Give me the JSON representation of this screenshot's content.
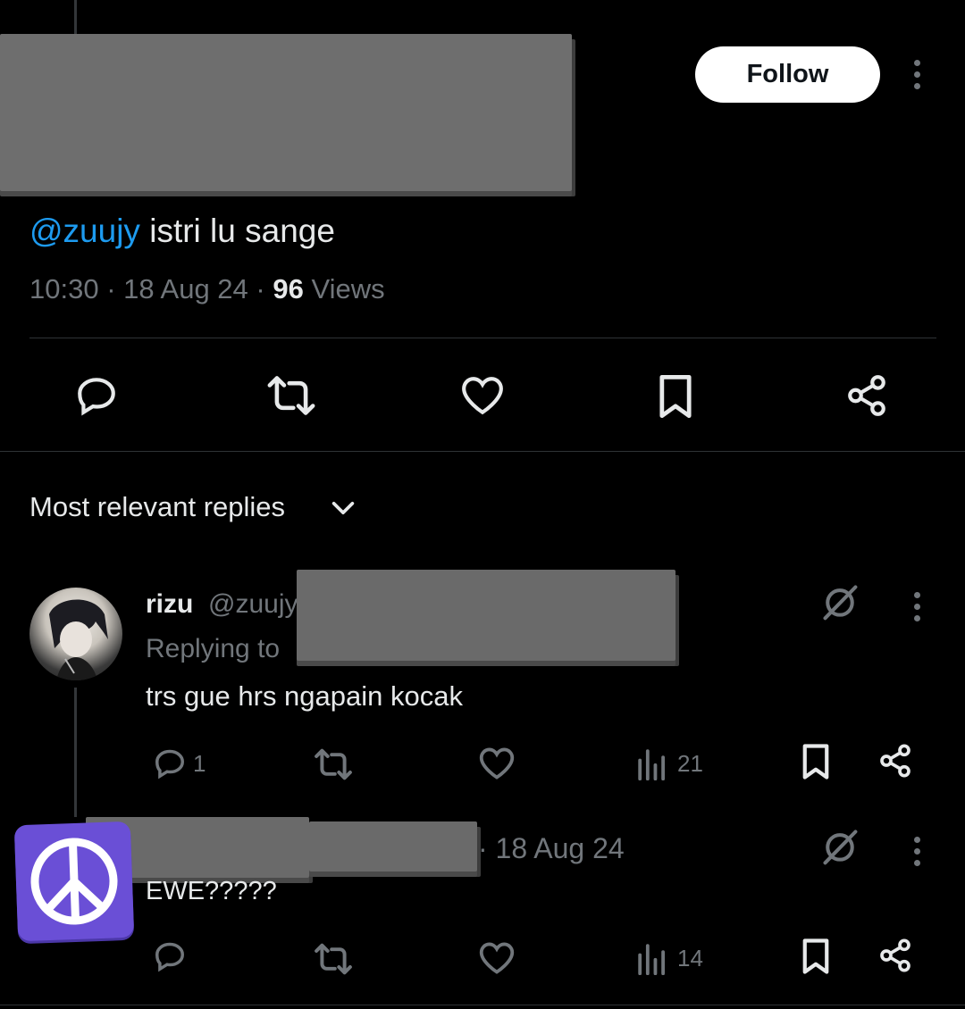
{
  "tweet": {
    "follow_label": "Follow",
    "mention": "@zuujy",
    "text": " istri lu sange",
    "time": "10:30",
    "date": "18 Aug 24",
    "views_count": "96",
    "views_label": "Views",
    "separator": " · "
  },
  "replies_header": {
    "label": "Most relevant replies"
  },
  "replies": [
    {
      "name": "rizu",
      "handle": "@zuujy",
      "replying_to": "Replying to",
      "text": "trs gue hrs ngapain kocak",
      "reply_count": "1",
      "views_count": "21"
    },
    {
      "date": "· 18 Aug 24",
      "text": "EWE?????",
      "views_count": "14"
    }
  ],
  "icons": {
    "reply": "speech-bubble-icon",
    "retweet": "retweet-icon",
    "like": "heart-icon",
    "bookmark": "bookmark-icon",
    "share": "share-icon",
    "views": "bar-chart-icon",
    "grok": "no-sign-icon",
    "more": "vertical-dots-icon",
    "sort": "chevron-down-icon",
    "peace": "peace-symbol-icon"
  },
  "colors": {
    "background": "#000000",
    "text": "#e7e9ea",
    "muted": "#71767b",
    "link": "#1d9bf0",
    "divider": "#2f3336",
    "peace_avatar": "#6a4fd6"
  }
}
